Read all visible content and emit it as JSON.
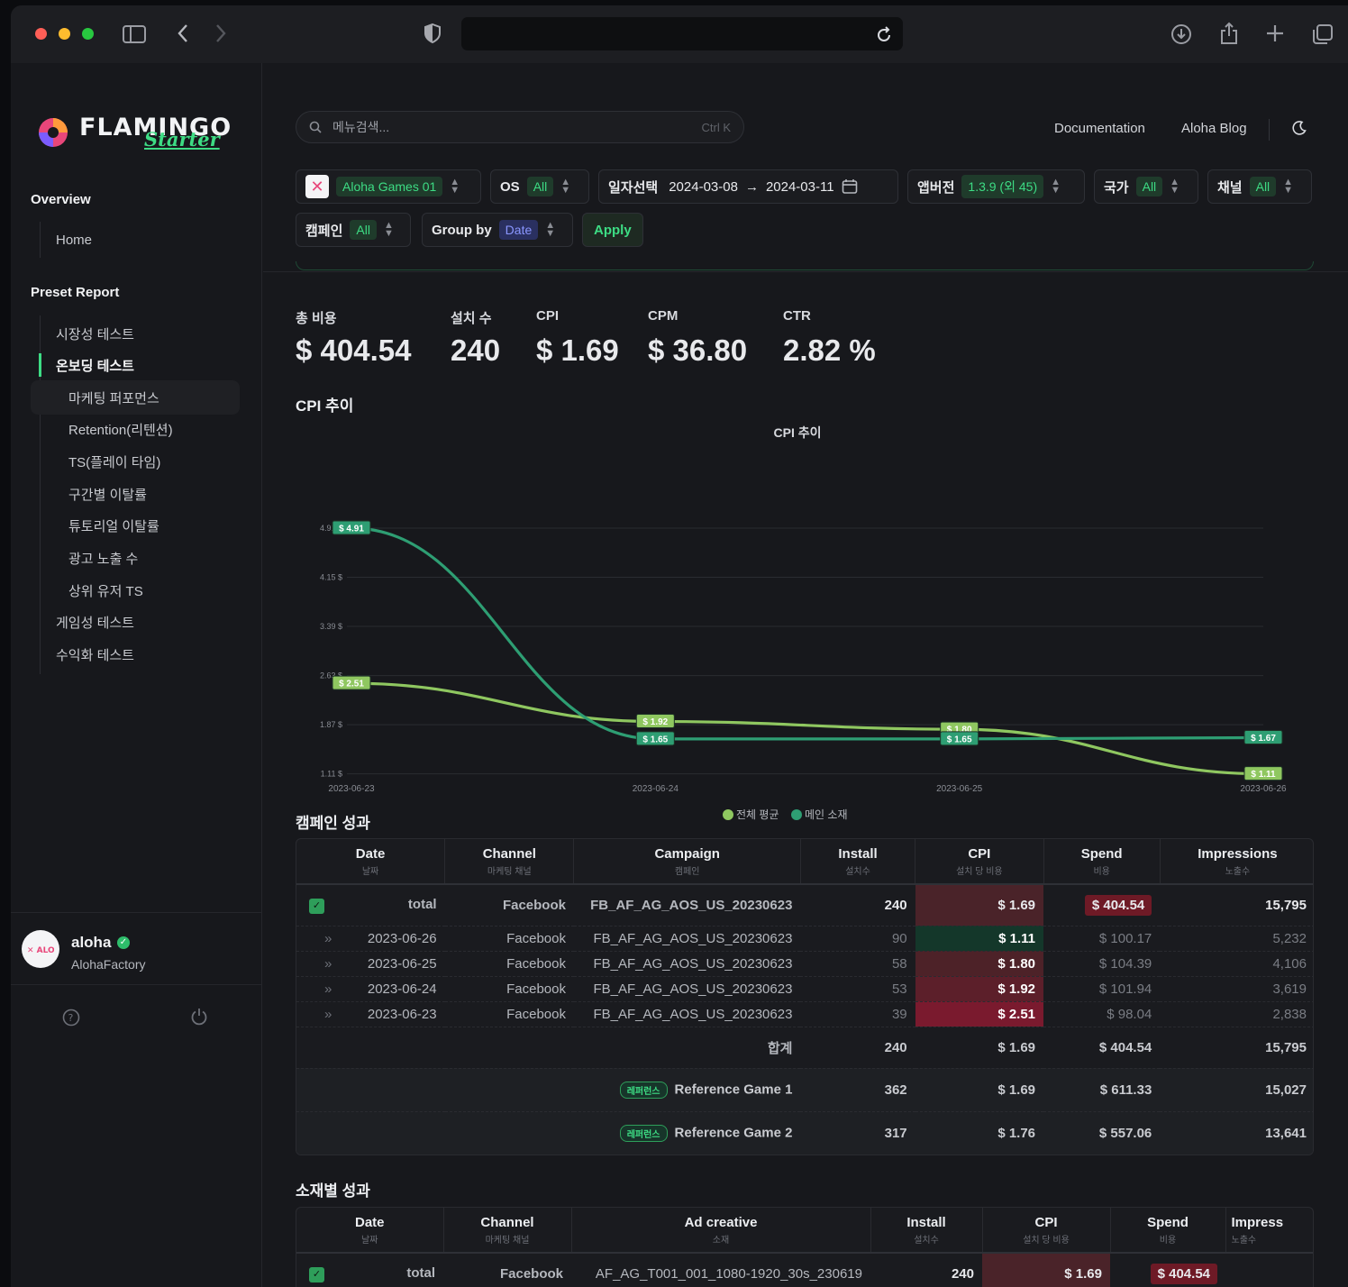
{
  "browser": {
    "reload_icon": "reload-icon"
  },
  "sidebar": {
    "brand": "FLAMINGO",
    "brand_sub": "Starter",
    "overview_heading": "Overview",
    "home": "Home",
    "preset_heading": "Preset Report",
    "items": [
      "시장성 테스트",
      "온보딩 테스트",
      "마케팅 퍼포먼스",
      "Retention(리텐션)",
      "TS(플레이 타임)",
      "구간별 이탈률",
      "튜토리얼 이탈률",
      "광고 노출 수",
      "상위 유저 TS",
      "게임성 테스트",
      "수익화 테스트"
    ],
    "user_name": "aloha",
    "user_org": "AlohaFactory"
  },
  "topbar": {
    "search_placeholder": "메뉴검색...",
    "search_shortcut": "Ctrl K",
    "documentation": "Documentation",
    "blog": "Aloha Blog"
  },
  "filters": {
    "game": "Aloha Games 01",
    "os_label": "OS",
    "os_value": "All",
    "date_label": "일자선택",
    "date_from": "2024-03-08",
    "date_arrow": "→",
    "date_to": "2024-03-11",
    "appver_label": "앱버전",
    "appver_value": "1.3.9 (외 45)",
    "country_label": "국가",
    "country_value": "All",
    "channel_label": "채널",
    "channel_value": "All",
    "campaign_label": "캠페인",
    "campaign_value": "All",
    "groupby_label": "Group by",
    "groupby_value": "Date",
    "apply": "Apply"
  },
  "kpis": [
    {
      "label": "총 비용",
      "value": "$ 404.54"
    },
    {
      "label": "설치 수",
      "value": "240"
    },
    {
      "label": "CPI",
      "value": "$ 1.69"
    },
    {
      "label": "CPM",
      "value": "$ 36.80"
    },
    {
      "label": "CTR",
      "value": "2.82 %"
    }
  ],
  "cpi_section_title": "CPI 추이",
  "chart_data": {
    "type": "line",
    "title": "CPI 추이",
    "x": [
      "2023-06-23",
      "2023-06-24",
      "2023-06-25",
      "2023-06-26"
    ],
    "y_ticks": [
      "4.91 $",
      "4.15 $",
      "3.39 $",
      "2.63 $",
      "1.87 $",
      "1.11 $"
    ],
    "ylim": [
      1.11,
      4.91
    ],
    "series": [
      {
        "name": "전체 평균",
        "color": "#8fc760",
        "values": [
          2.51,
          1.92,
          1.8,
          1.11
        ],
        "labels": [
          "$ 2.51",
          "$ 1.92",
          "$ 1.80",
          "$ 1.11"
        ]
      },
      {
        "name": "메인 소재",
        "color": "#2e9e73",
        "values": [
          4.91,
          1.65,
          1.65,
          1.67
        ],
        "labels": [
          "$ 4.91",
          "$ 1.65",
          "$ 1.65",
          "$ 1.67"
        ]
      }
    ],
    "grid": true,
    "legend": "bottom-center"
  },
  "campaign": {
    "title": "캠페인 성과",
    "headers": [
      {
        "t": "Date",
        "s": "날짜"
      },
      {
        "t": "Channel",
        "s": "마케팅 채널"
      },
      {
        "t": "Campaign",
        "s": "캠페인"
      },
      {
        "t": "Install",
        "s": "설치수"
      },
      {
        "t": "CPI",
        "s": "설치 당 비용"
      },
      {
        "t": "Spend",
        "s": "비용"
      },
      {
        "t": "Impressions",
        "s": "노출수"
      }
    ],
    "total": {
      "date": "total",
      "channel": "Facebook",
      "campaign": "FB_AF_AG_AOS_US_20230623",
      "install": "240",
      "cpi": "$ 1.69",
      "spend": "$ 404.54",
      "impressions": "15,795"
    },
    "rows": [
      {
        "date": "2023-06-26",
        "channel": "Facebook",
        "campaign": "FB_AF_AG_AOS_US_20230623",
        "install": "90",
        "cpi": "$ 1.11",
        "spend": "$ 100.17",
        "impressions": "5,232"
      },
      {
        "date": "2023-06-25",
        "channel": "Facebook",
        "campaign": "FB_AF_AG_AOS_US_20230623",
        "install": "58",
        "cpi": "$ 1.80",
        "spend": "$ 104.39",
        "impressions": "4,106"
      },
      {
        "date": "2023-06-24",
        "channel": "Facebook",
        "campaign": "FB_AF_AG_AOS_US_20230623",
        "install": "53",
        "cpi": "$ 1.92",
        "spend": "$ 101.94",
        "impressions": "3,619"
      },
      {
        "date": "2023-06-23",
        "channel": "Facebook",
        "campaign": "FB_AF_AG_AOS_US_20230623",
        "install": "39",
        "cpi": "$ 2.51",
        "spend": "$ 98.04",
        "impressions": "2,838"
      }
    ],
    "sum": {
      "label": "합계",
      "install": "240",
      "cpi": "$ 1.69",
      "spend": "$ 404.54",
      "impressions": "15,795"
    },
    "refs": [
      {
        "badge": "레퍼런스",
        "name": "Reference Game 1",
        "install": "362",
        "cpi": "$ 1.69",
        "spend": "$ 611.33",
        "impressions": "15,027"
      },
      {
        "badge": "레퍼런스",
        "name": "Reference Game 2",
        "install": "317",
        "cpi": "$ 1.76",
        "spend": "$ 557.06",
        "impressions": "13,641"
      }
    ]
  },
  "creative": {
    "title": "소재별 성과",
    "headers": [
      {
        "t": "Date",
        "s": "날짜"
      },
      {
        "t": "Channel",
        "s": "마케팅 채널"
      },
      {
        "t": "Ad creative",
        "s": "소재"
      },
      {
        "t": "Install",
        "s": "설치수"
      },
      {
        "t": "CPI",
        "s": "설치 당 비용"
      },
      {
        "t": "Spend",
        "s": "비용"
      },
      {
        "t": "Impress",
        "s": "노출수"
      }
    ],
    "total": {
      "date": "total",
      "channel": "Facebook",
      "creative": "AF_AG_T001_001_1080-1920_30s_230619",
      "install": "240",
      "cpi": "$ 1.69",
      "spend": "$ 404.54"
    }
  }
}
